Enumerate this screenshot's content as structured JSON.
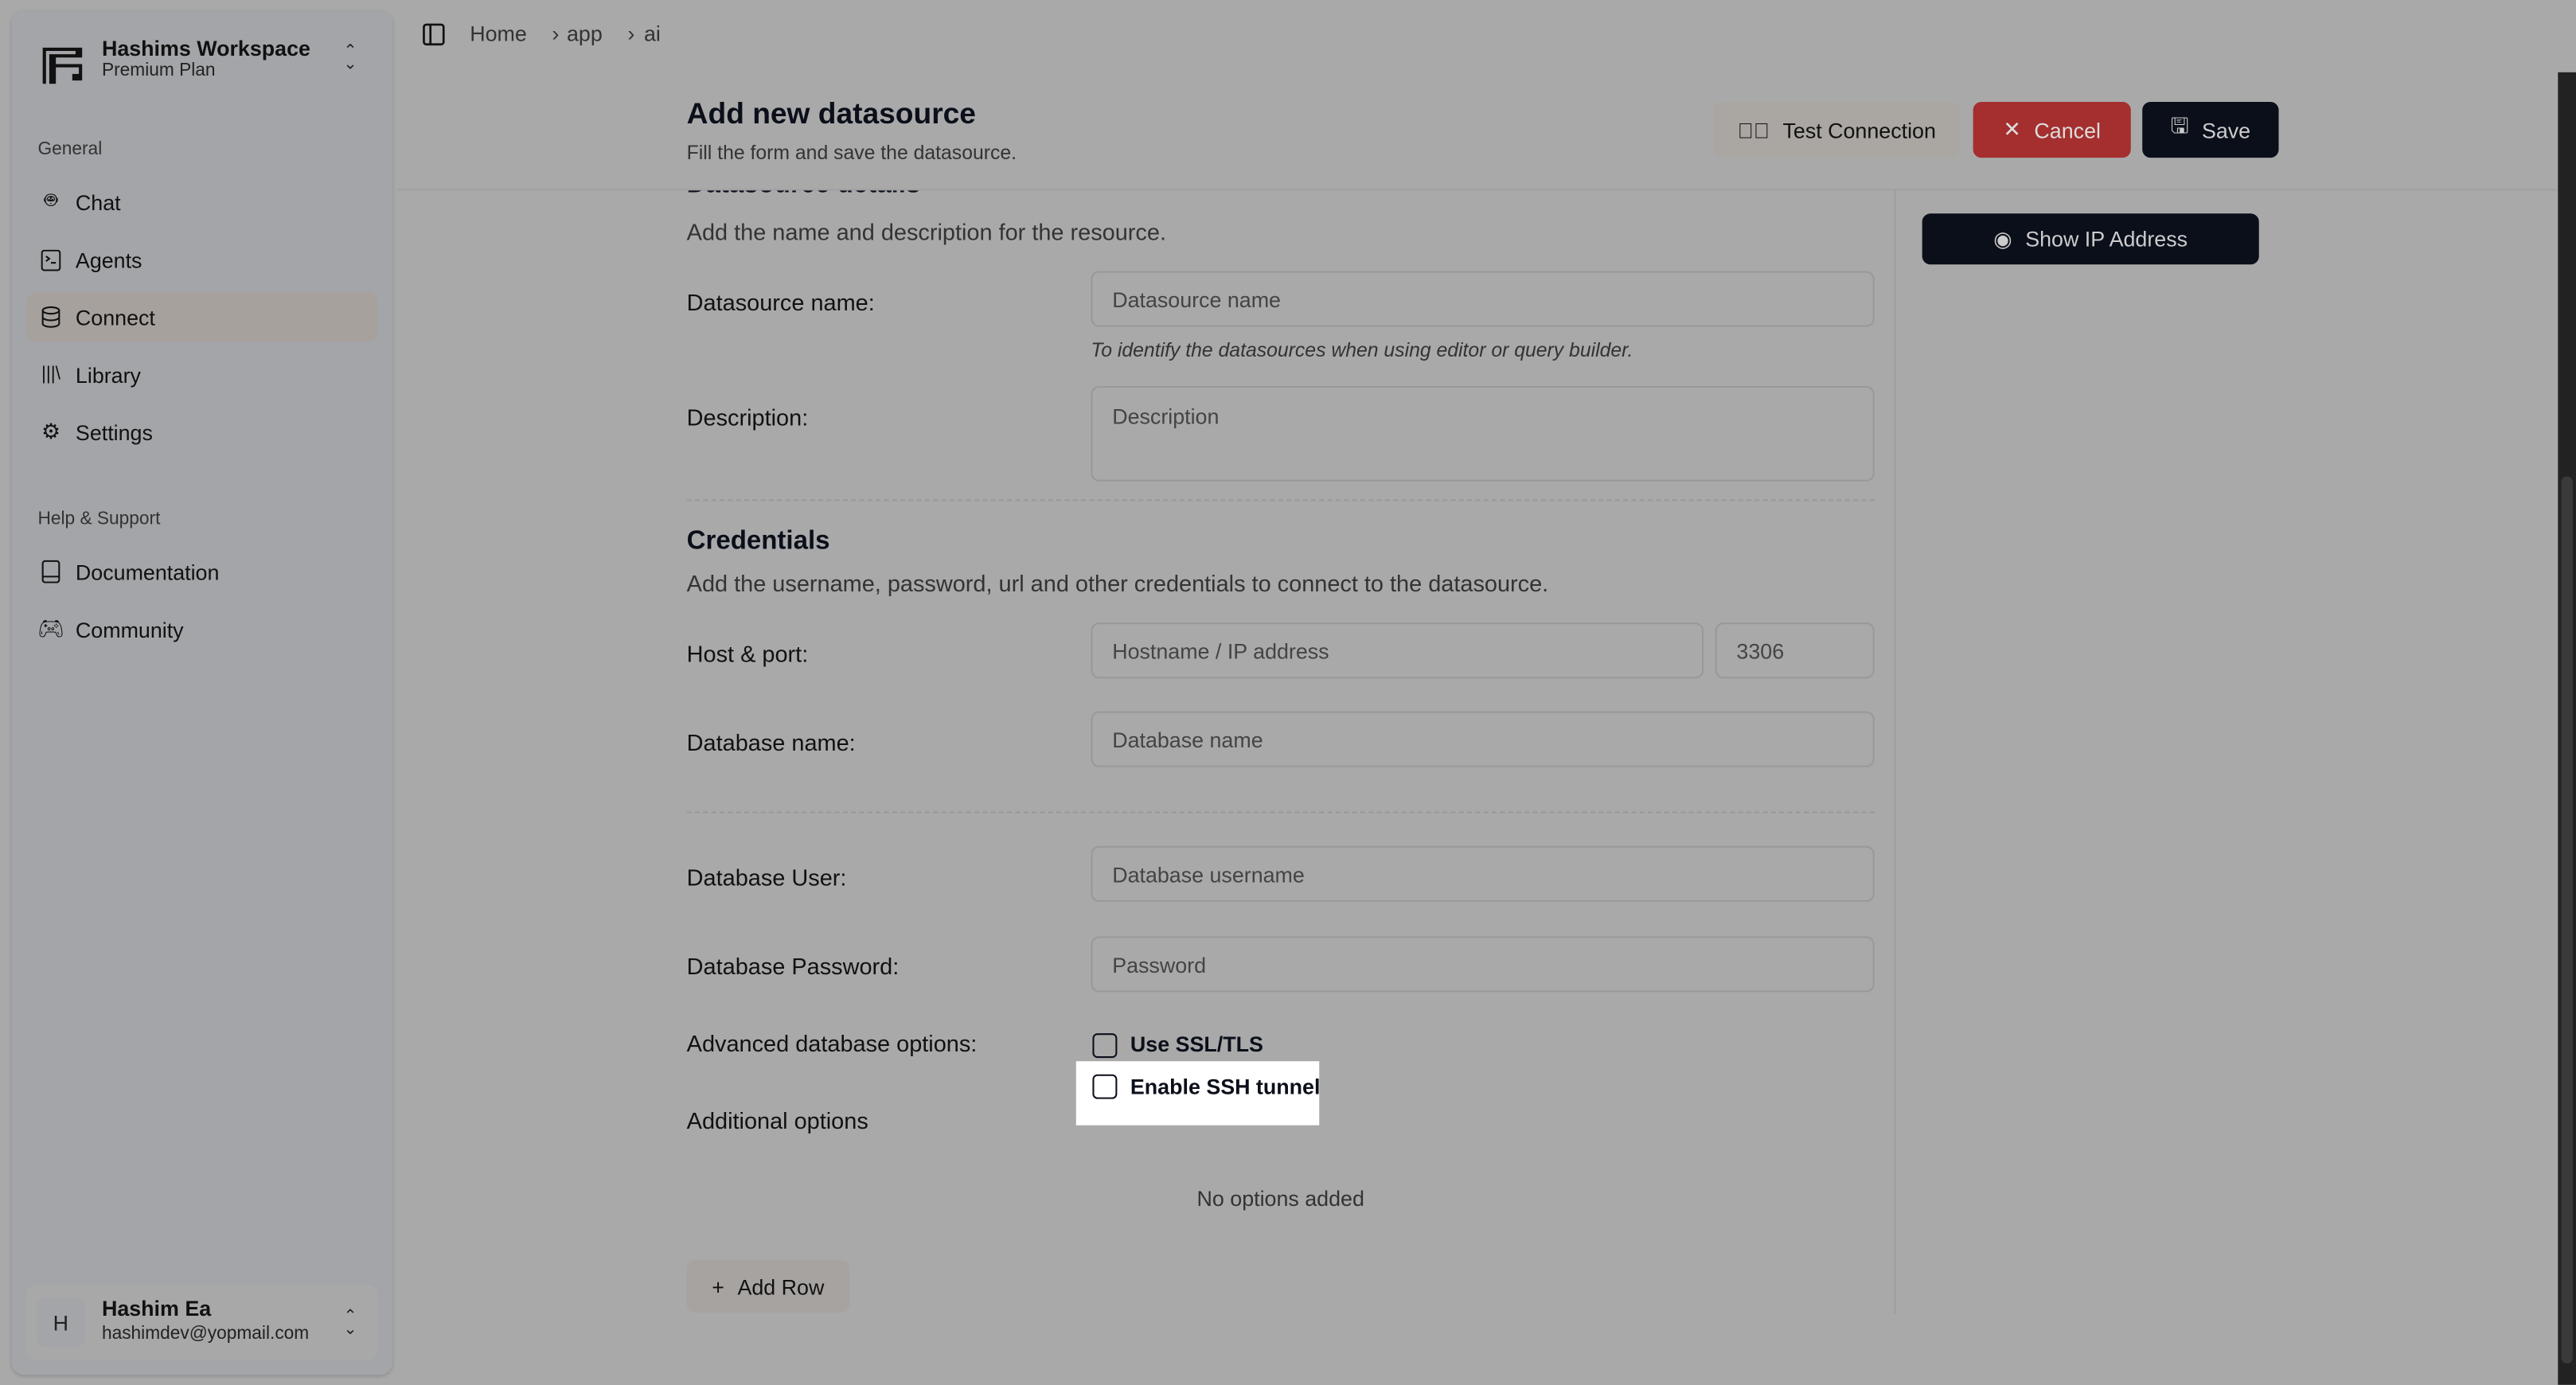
{
  "sidebar": {
    "workspace_name": "Hashims Workspace",
    "workspace_plan": "Premium Plan",
    "section_general": "General",
    "items": [
      {
        "label": "Chat",
        "icon": "bot-icon"
      },
      {
        "label": "Agents",
        "icon": "terminal-icon"
      },
      {
        "label": "Connect",
        "icon": "database-icon",
        "active": true
      },
      {
        "label": "Library",
        "icon": "library-icon"
      },
      {
        "label": "Settings",
        "icon": "gear-icon"
      }
    ],
    "section_help": "Help & Support",
    "help_items": [
      {
        "label": "Documentation",
        "icon": "book-icon"
      },
      {
        "label": "Community",
        "icon": "gamepad-icon"
      }
    ],
    "user": {
      "initial": "H",
      "name": "Hashim Ea",
      "email": "hashimdev@yopmail.com"
    }
  },
  "breadcrumb": [
    "Home",
    "app",
    "ai"
  ],
  "header": {
    "title": "Add new datasource",
    "subtitle": "Fill the form and save the datasource.",
    "test_label": "Test Connection",
    "cancel_label": "Cancel",
    "save_label": "Save"
  },
  "side_panel": {
    "show_ip_label": "Show IP Address"
  },
  "form": {
    "details_title": "Datasource details",
    "details_desc": "Add the name and description for the resource.",
    "name_label": "Datasource name:",
    "name_placeholder": "Datasource name",
    "name_hint": "To identify the datasources when using editor or query builder.",
    "desc_label": "Description:",
    "desc_placeholder": "Description",
    "cred_title": "Credentials",
    "cred_desc": "Add the username, password, url and other credentials to connect to the datasource.",
    "host_label": "Host & port:",
    "host_placeholder": "Hostname / IP address",
    "port_placeholder": "3306",
    "dbname_label": "Database name:",
    "dbname_placeholder": "Database name",
    "user_label": "Database User:",
    "user_placeholder": "Database username",
    "pass_label": "Database Password:",
    "pass_placeholder": "Password",
    "adv_label": "Advanced database options:",
    "ssl_label": "Use SSL/TLS",
    "ssl_checked": false,
    "ssh_label": "Enable SSH tunnel",
    "ssh_checked": false,
    "additional_label": "Additional options",
    "no_options": "No options added",
    "add_row_label": "Add Row"
  },
  "colors": {
    "cancel": "#a52e2e",
    "primary": "#0b0f1a",
    "highlight": "#ffffff"
  }
}
